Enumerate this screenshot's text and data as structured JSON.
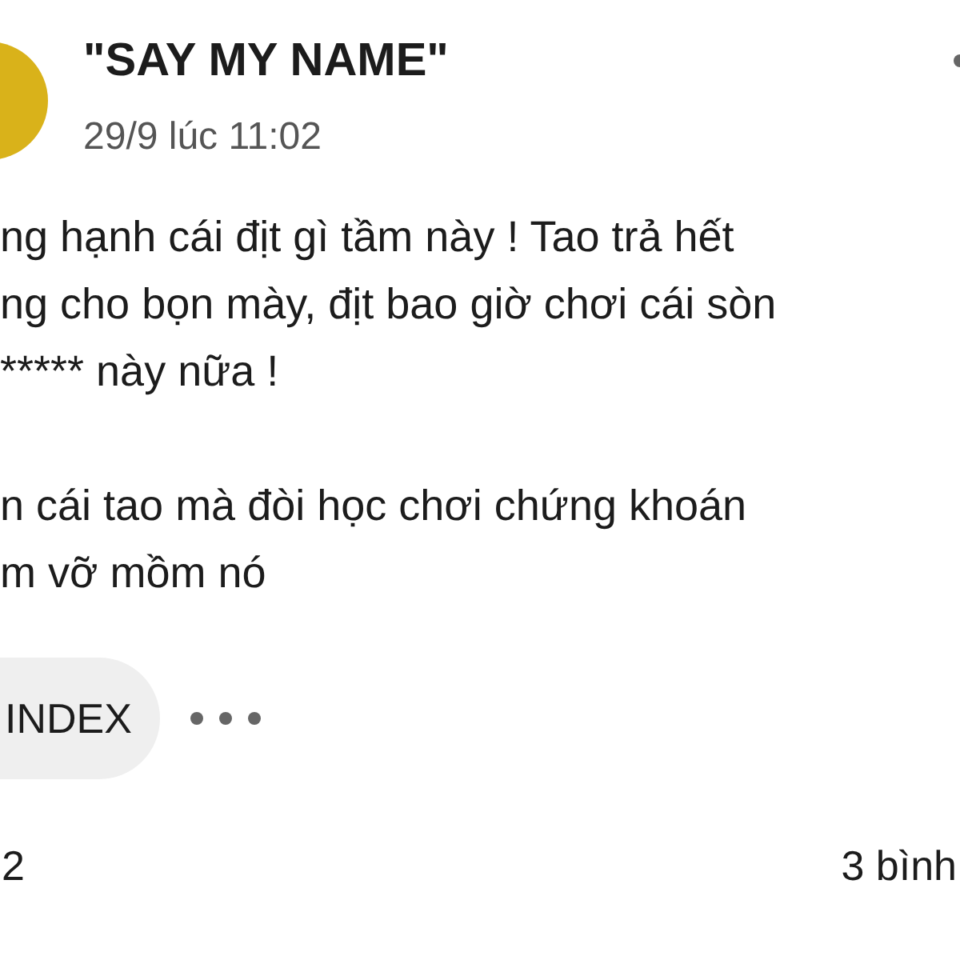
{
  "post": {
    "author": "\"SAY MY NAME\"",
    "time": "29/9 lúc 11:02",
    "paragraphs": [
      {
        "lines": [
          "ng hạnh cái địt gì tầm này ! Tao trả hết",
          "ng cho bọn mày, địt bao giờ chơi cái sòn",
          "***** này nữa !"
        ]
      },
      {
        "lines": [
          "n cái tao mà đòi học chơi chứng khoán",
          "m vỡ mồm nó"
        ]
      }
    ],
    "tags": [
      "INDEX"
    ],
    "reactions_count": "2",
    "comments_count": "3 bình"
  }
}
